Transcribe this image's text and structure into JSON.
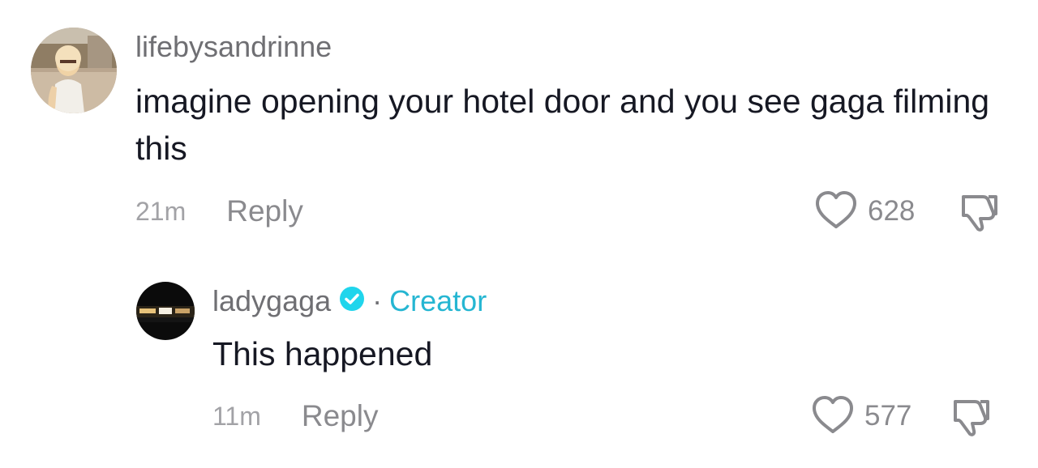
{
  "comments": [
    {
      "username": "lifebysandrinne",
      "text": "imagine opening your hotel door and you see gaga filming this",
      "time": "21m",
      "reply_label": "Reply",
      "likes": "628"
    },
    {
      "username": "ladygaga",
      "separator": "·",
      "creator_label": "Creator",
      "text": "This happened",
      "time": "11m",
      "reply_label": "Reply",
      "likes": "577"
    }
  ],
  "colors": {
    "creator": "#25b6d2",
    "verified": "#20d5ec",
    "muted": "#8a8a8e"
  }
}
